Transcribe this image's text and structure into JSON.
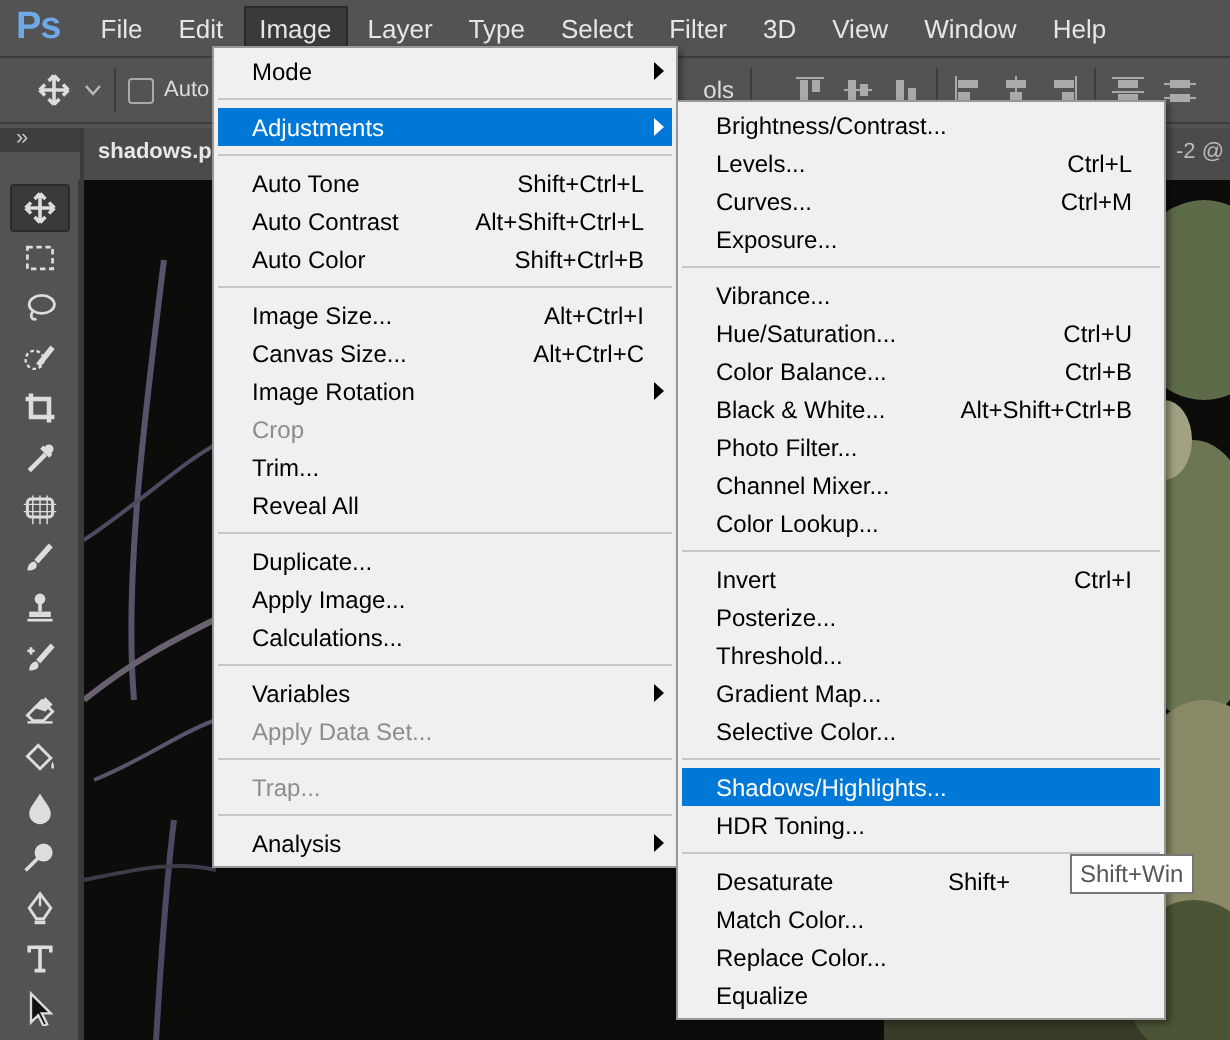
{
  "menubar": {
    "logo": "Ps",
    "items": [
      {
        "label": "File",
        "selected": false
      },
      {
        "label": "Edit",
        "selected": false
      },
      {
        "label": "Image",
        "selected": true
      },
      {
        "label": "Layer",
        "selected": false
      },
      {
        "label": "Type",
        "selected": false
      },
      {
        "label": "Select",
        "selected": false
      },
      {
        "label": "Filter",
        "selected": false
      },
      {
        "label": "3D",
        "selected": false
      },
      {
        "label": "View",
        "selected": false
      },
      {
        "label": "Window",
        "selected": false
      },
      {
        "label": "Help",
        "selected": false
      }
    ]
  },
  "options_bar": {
    "auto_label": "Auto",
    "auto_checked": false,
    "column_2": "ols"
  },
  "panel_toggle": "»",
  "document_tab": {
    "title": "shadows.p",
    "title_end": "-2 @"
  },
  "tools": [
    {
      "kind": "move",
      "selected": true
    },
    {
      "kind": "marquee",
      "selected": false
    },
    {
      "kind": "lasso",
      "selected": false
    },
    {
      "kind": "quick-select",
      "selected": false
    },
    {
      "kind": "crop",
      "selected": false
    },
    {
      "kind": "eyedropper",
      "selected": false
    },
    {
      "kind": "patch",
      "selected": false
    },
    {
      "kind": "brush",
      "selected": false
    },
    {
      "kind": "stamp",
      "selected": false
    },
    {
      "kind": "history-brush",
      "selected": false
    },
    {
      "kind": "eraser",
      "selected": false
    },
    {
      "kind": "bucket",
      "selected": false
    },
    {
      "kind": "drop",
      "selected": false
    },
    {
      "kind": "dodge",
      "selected": false
    },
    {
      "kind": "pen",
      "selected": false
    },
    {
      "kind": "type",
      "selected": false
    },
    {
      "kind": "arrow",
      "selected": false
    }
  ],
  "image_menu": {
    "groups": [
      [
        {
          "label": "Mode",
          "submenu": true,
          "disabled": false,
          "selected": false
        }
      ],
      [
        {
          "label": "Adjustments",
          "submenu": true,
          "disabled": false,
          "selected": true
        }
      ],
      [
        {
          "label": "Auto Tone",
          "shortcut": "Shift+Ctrl+L",
          "disabled": false,
          "selected": false
        },
        {
          "label": "Auto Contrast",
          "shortcut": "Alt+Shift+Ctrl+L",
          "disabled": false,
          "selected": false
        },
        {
          "label": "Auto Color",
          "shortcut": "Shift+Ctrl+B",
          "disabled": false,
          "selected": false
        }
      ],
      [
        {
          "label": "Image Size...",
          "shortcut": "Alt+Ctrl+I",
          "disabled": false,
          "selected": false
        },
        {
          "label": "Canvas Size...",
          "shortcut": "Alt+Ctrl+C",
          "disabled": false,
          "selected": false
        },
        {
          "label": "Image Rotation",
          "submenu": true,
          "disabled": false,
          "selected": false
        },
        {
          "label": "Crop",
          "disabled": true,
          "selected": false
        },
        {
          "label": "Trim...",
          "disabled": false,
          "selected": false
        },
        {
          "label": "Reveal All",
          "disabled": false,
          "selected": false
        }
      ],
      [
        {
          "label": "Duplicate...",
          "disabled": false,
          "selected": false
        },
        {
          "label": "Apply Image...",
          "disabled": false,
          "selected": false
        },
        {
          "label": "Calculations...",
          "disabled": false,
          "selected": false
        }
      ],
      [
        {
          "label": "Variables",
          "submenu": true,
          "disabled": false,
          "selected": false
        },
        {
          "label": "Apply Data Set...",
          "disabled": true,
          "selected": false
        }
      ],
      [
        {
          "label": "Trap...",
          "disabled": true,
          "selected": false
        }
      ],
      [
        {
          "label": "Analysis",
          "submenu": true,
          "disabled": false,
          "selected": false
        }
      ]
    ]
  },
  "adjustments_menu": {
    "groups": [
      [
        {
          "label": "Brightness/Contrast...",
          "disabled": false,
          "selected": false
        },
        {
          "label": "Levels...",
          "shortcut": "Ctrl+L",
          "disabled": false,
          "selected": false
        },
        {
          "label": "Curves...",
          "shortcut": "Ctrl+M",
          "disabled": false,
          "selected": false
        },
        {
          "label": "Exposure...",
          "disabled": false,
          "selected": false
        }
      ],
      [
        {
          "label": "Vibrance...",
          "disabled": false,
          "selected": false
        },
        {
          "label": "Hue/Saturation...",
          "shortcut": "Ctrl+U",
          "disabled": false,
          "selected": false
        },
        {
          "label": "Color Balance...",
          "shortcut": "Ctrl+B",
          "disabled": false,
          "selected": false
        },
        {
          "label": "Black & White...",
          "shortcut": "Alt+Shift+Ctrl+B",
          "disabled": false,
          "selected": false
        },
        {
          "label": "Photo Filter...",
          "disabled": false,
          "selected": false
        },
        {
          "label": "Channel Mixer...",
          "disabled": false,
          "selected": false
        },
        {
          "label": "Color Lookup...",
          "disabled": false,
          "selected": false
        }
      ],
      [
        {
          "label": "Invert",
          "shortcut": "Ctrl+I",
          "disabled": false,
          "selected": false
        },
        {
          "label": "Posterize...",
          "disabled": false,
          "selected": false
        },
        {
          "label": "Threshold...",
          "disabled": false,
          "selected": false
        },
        {
          "label": "Gradient Map...",
          "disabled": false,
          "selected": false
        },
        {
          "label": "Selective Color...",
          "disabled": false,
          "selected": false
        }
      ],
      [
        {
          "label": "Shadows/Highlights...",
          "disabled": false,
          "selected": true
        },
        {
          "label": "HDR Toning...",
          "disabled": false,
          "selected": false
        }
      ],
      [
        {
          "label": "Desaturate",
          "shortcut": "Shift+",
          "disabled": false,
          "selected": false
        },
        {
          "label": "Match Color...",
          "disabled": false,
          "selected": false
        },
        {
          "label": "Replace Color...",
          "disabled": false,
          "selected": false
        },
        {
          "label": "Equalize",
          "disabled": false,
          "selected": false
        }
      ]
    ]
  },
  "tooltip": {
    "text": "Shift+Win"
  }
}
